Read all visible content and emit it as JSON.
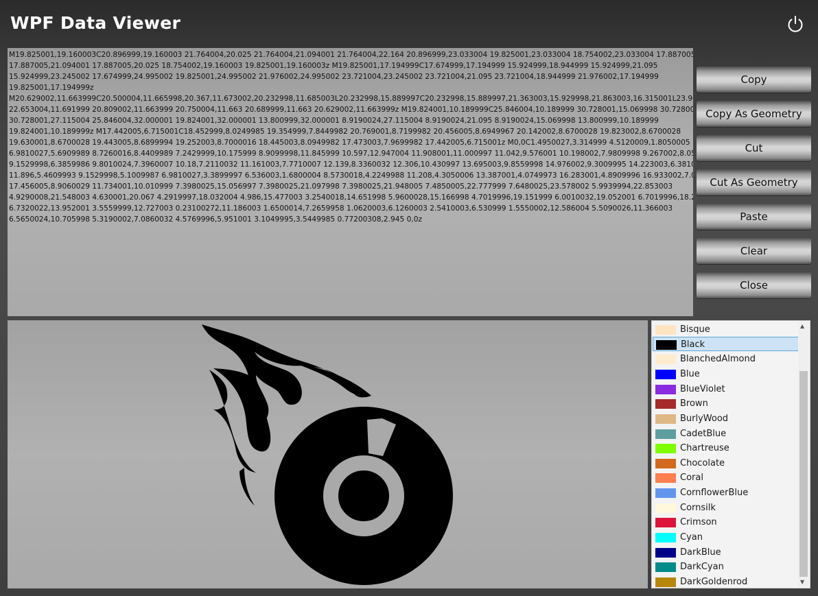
{
  "app": {
    "title": "WPF Data Viewer"
  },
  "geometry_text": "M19.825001,19.160003C20.896999,19.160003 21.764004,20.025 21.764004,21.094001 21.764004,22.164 20.896999,23.033004 19.825001,23.033004 18.754002,23.033004 17.887005,22.164\n17.887005,21.094001 17.887005,20.025 18.754002,19.160003 19.825001,19.160003z M19.825001,17.194999C17.674999,17.194999 15.924999,18.944999 15.924999,21.095\n15.924999,23.245002 17.674999,24.995002 19.825001,24.995002 21.976002,24.995002 23.721004,23.245002 23.721004,21.095 23.721004,18.944999 21.976002,17.194999\n19.825001,17.194999z\nM20.629002,11.663999C20.500004,11.665998,20.367,11.673002,20.232998,11.685003L20.232998,15.889997C20.232998,15.889997,21.363003,15.929998,21.863003,16.315001L23.909,12.6450\n22.653004,11.691999 20.809002,11.663999 20.750004,11.663 20.689999,11.663 20.629002,11.663999z M19.824001,10.189999C25.846004,10.189999 30.728001,15.069998 30.728001,21.095\n30.728001,27.115004 25.846004,32.000001 19.824001,32.000001 13.800999,32.000001 8.9190024,27.115004 8.9190024,21.095 8.9190024,15.069998 13.800999,10.189999\n19.824001,10.189999z M17.442005,6.715001C18.452999,8.0249985 19.354999,7.8449982 20.769001,8.7199982 20.456005,8.6949967 20.142002,8.6700028 19.823002,8.6700028\n19.630001,8.6700028 19.443005,8.6899994 19.252003,8.7000016 18.445003,8.0949982 17.473003,7.9699982 17.442005,6.715001z M0,0C1.4950027,3.314999 4.5120009,1.8050005\n6.9810027,5.6909989 8.7260016,8.4409989 7.2429999,10.175999 8.9099998,11.845999 10.597,12.947004 11.908001,11.000997 11.042,9.576001 10.198002,7.9809998 9.267002,8.0559967\n9.1529998,6.3859986 9.8010024,7.3960007 10.18,7.2110032 11.161003,7.7710007 12.139,8.3360032 12.306,10.430997 13.695003,9.8559998 14.976002,9.3009995 14.223003,6.3810013\n11.896,5.4609993 9.1529998,5.1009987 6.9810027,3.3899997 6.536003,1.6800004 8.5730018,4.2249988 11.208,4.3050006 13.387001,4.0749973 16.283001,4.8909996 16.933002,7.0060013\n17.456005,8.9060029 11.734001,10.010999 7.3980025,15.056997 7.3980025,21.097998 7.3980025,21.948005 7.4850005,22.777999 7.6480025,23.578002 5.9939994,22.853003\n4.9290008,21.548003 4.630001,20.067 4.2919997,18.032004 4.986,15.477003 3.2540018,14.651998 5.9600028,15.166998 4.7019996,19.151999 6.0010032,19.052001 6.7019996,18.242003\n6.7320022,13.952001 3.5559999,12.727003 0.23100272,11.186003 1.6500014,7.2659958 1.0620003,6.1260003 2.5410003,6.530999 1.5550002,12.586004 5.5090026,11.366003\n6.5650024,10.705998 5.3190002,7.0860032 4.5769996,5.951001 3.1049995,3.5449985 0.77200308,2.945 0,0z",
  "buttons": {
    "copy": "Copy",
    "copy_geometry": "Copy As Geometry",
    "cut": "Cut",
    "cut_geometry": "Cut As Geometry",
    "paste": "Paste",
    "clear": "Clear",
    "close": "Close"
  },
  "colors": {
    "selected": "Black",
    "items": [
      {
        "name": "Bisque",
        "hex": "#FFE4C4"
      },
      {
        "name": "Black",
        "hex": "#000000"
      },
      {
        "name": "BlanchedAlmond",
        "hex": "#FFEBCD"
      },
      {
        "name": "Blue",
        "hex": "#0000FF"
      },
      {
        "name": "BlueViolet",
        "hex": "#8A2BE2"
      },
      {
        "name": "Brown",
        "hex": "#A52A2A"
      },
      {
        "name": "BurlyWood",
        "hex": "#DEB887"
      },
      {
        "name": "CadetBlue",
        "hex": "#5F9EA0"
      },
      {
        "name": "Chartreuse",
        "hex": "#7FFF00"
      },
      {
        "name": "Chocolate",
        "hex": "#D2691E"
      },
      {
        "name": "Coral",
        "hex": "#FF7F50"
      },
      {
        "name": "CornflowerBlue",
        "hex": "#6495ED"
      },
      {
        "name": "Cornsilk",
        "hex": "#FFF8DC"
      },
      {
        "name": "Crimson",
        "hex": "#DC143C"
      },
      {
        "name": "Cyan",
        "hex": "#00FFFF"
      },
      {
        "name": "DarkBlue",
        "hex": "#00008B"
      },
      {
        "name": "DarkCyan",
        "hex": "#008B8B"
      },
      {
        "name": "DarkGoldenrod",
        "hex": "#B8860B"
      }
    ]
  },
  "preview": {
    "icon": "flaming-disc-icon",
    "fill": "#000000"
  }
}
